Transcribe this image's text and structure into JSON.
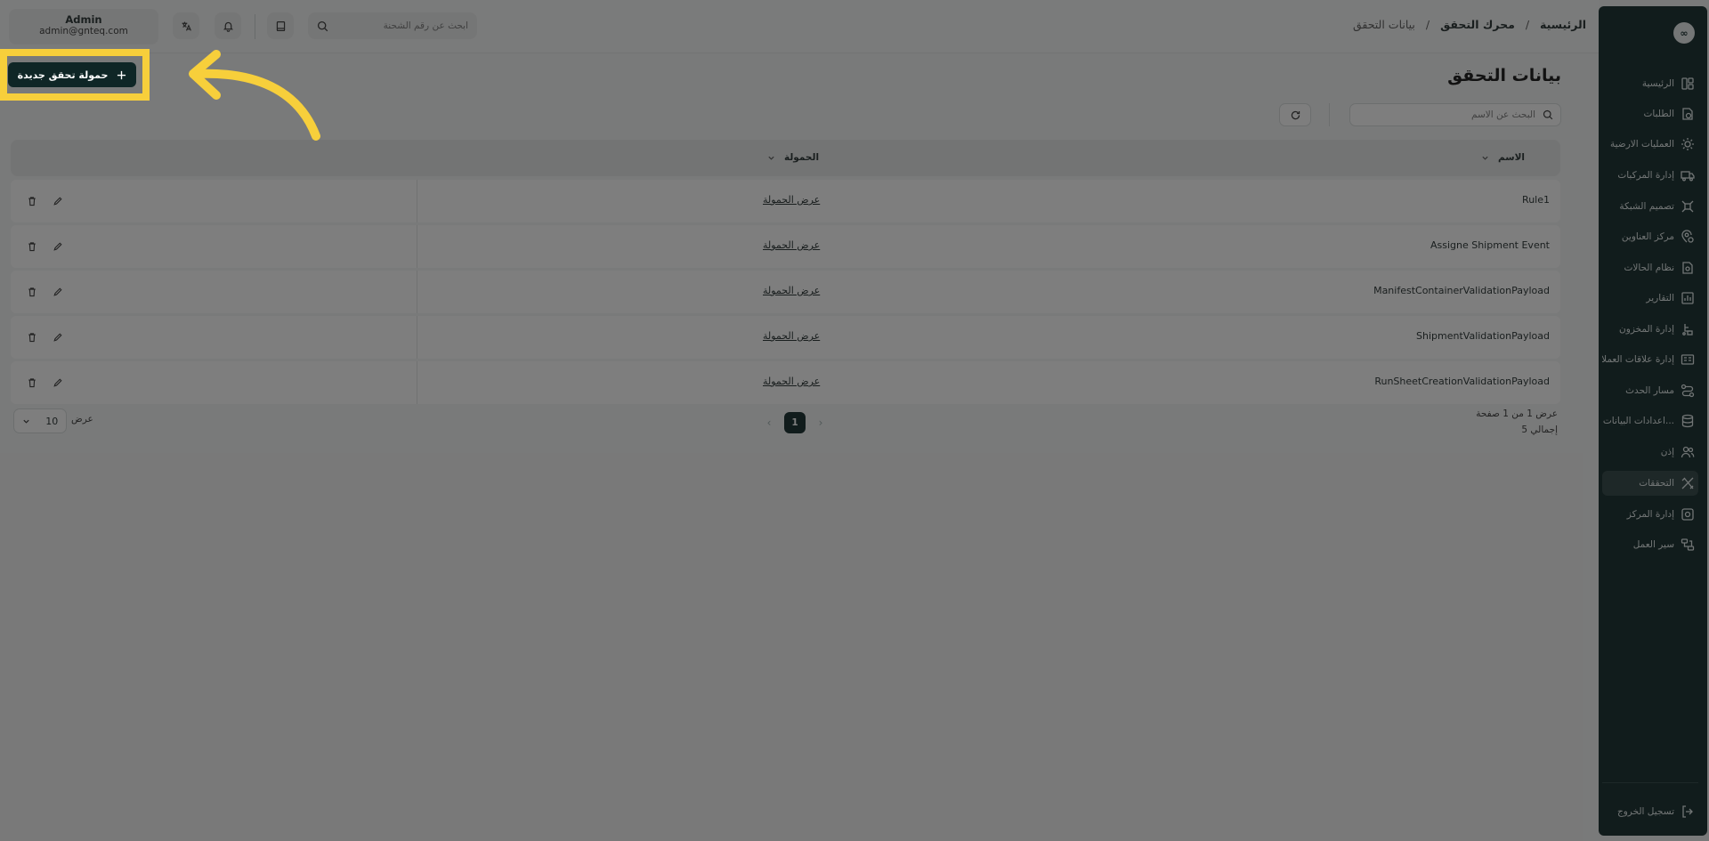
{
  "sidebar": {
    "logo": "∞",
    "items": [
      {
        "label": "الرئيسية",
        "icon": "dashboard-icon"
      },
      {
        "label": "الطلبات",
        "icon": "orders-icon"
      },
      {
        "label": "العمليات الارضية",
        "icon": "ground-ops-icon"
      },
      {
        "label": "إدارة المركبات",
        "icon": "truck-icon"
      },
      {
        "label": "تصميم الشبكة",
        "icon": "network-icon"
      },
      {
        "label": "مركز العناوين",
        "icon": "address-icon"
      },
      {
        "label": "نظام الحالات",
        "icon": "status-icon"
      },
      {
        "label": "التقارير",
        "icon": "reports-icon"
      },
      {
        "label": "إدارة المخزون",
        "icon": "inventory-icon"
      },
      {
        "label": "إدارة علاقات العملاء",
        "icon": "crm-icon"
      },
      {
        "label": "مسار الحدث",
        "icon": "event-route-icon"
      },
      {
        "label": "اعدادات البيانات...",
        "icon": "database-icon"
      },
      {
        "label": "إذن",
        "icon": "users-icon"
      },
      {
        "label": "التحققات",
        "icon": "validation-icon"
      },
      {
        "label": "إدارة المركز",
        "icon": "center-icon"
      },
      {
        "label": "سير العمل",
        "icon": "workflow-icon"
      }
    ],
    "active_index": 13,
    "logout_label": "تسجيل الخروج"
  },
  "header": {
    "breadcrumb": [
      "الرئيسية",
      "محرك التحقق",
      "بيانات التحقق"
    ],
    "search_placeholder": "ابحث عن رقم الشحنة",
    "user_name": "Admin",
    "user_email": "admin@gnteq.com"
  },
  "main": {
    "title": "بيانات التحقق",
    "new_button_label": "حمولة تحقق جديدة",
    "name_search_placeholder": "البحث عن الاسم",
    "columns": {
      "name": "الاسم",
      "payload": "الحمولة"
    },
    "rows": [
      {
        "name": "Rule1",
        "payload_link": "عرض الحمولة"
      },
      {
        "name": "Assigne Shipment Event",
        "payload_link": "عرض الحمولة"
      },
      {
        "name": "ManifestContainerValidationPayload",
        "payload_link": "عرض الحمولة"
      },
      {
        "name": "ShipmentValidationPayload",
        "payload_link": "عرض الحمولة"
      },
      {
        "name": "RunSheetCreationValidationPayload",
        "payload_link": "عرض الحمولة"
      }
    ],
    "pagination": {
      "page_info": "عرض 1 من 1 صفحة",
      "total": "إجمالي 5",
      "current_page": "1",
      "per_page_label": "عرض",
      "per_page_value": "10"
    }
  },
  "colors": {
    "primary": "#0f2626",
    "highlight": "#f7cf3b"
  }
}
